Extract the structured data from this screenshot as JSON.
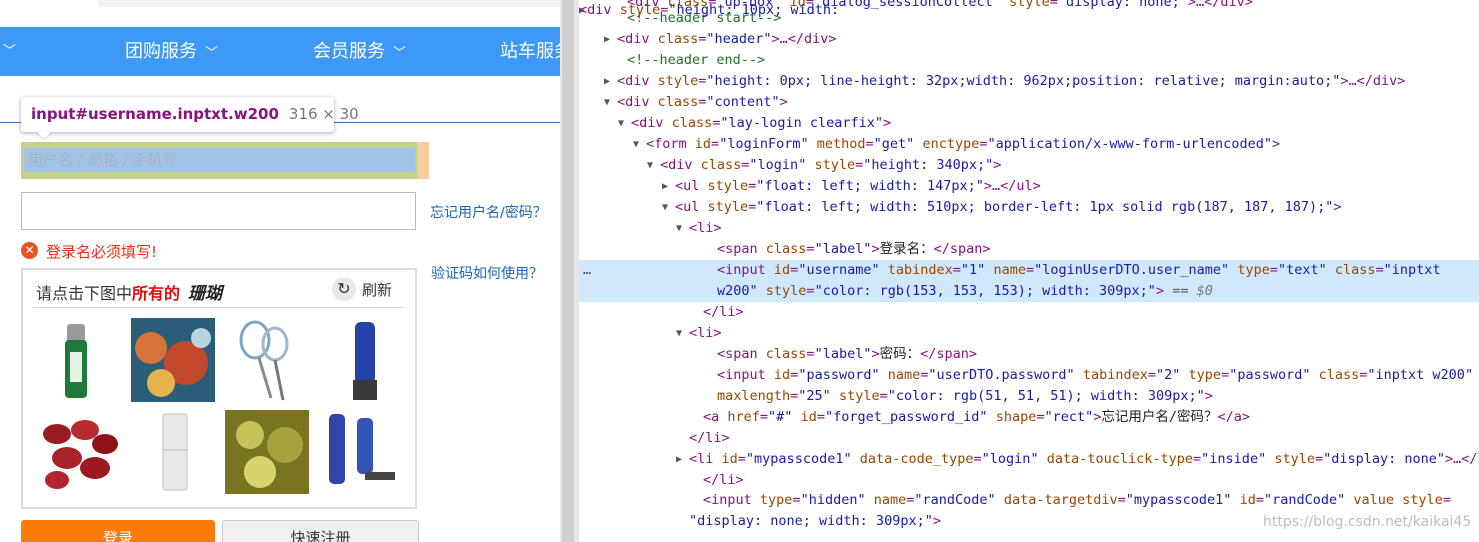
{
  "page": {
    "nav": [
      {
        "label": "团购服务"
      },
      {
        "label": "会员服务"
      },
      {
        "label": "站车服务"
      }
    ],
    "tooltip": {
      "selector": "input#username.inptxt.w200",
      "size": "316 × 30"
    },
    "username_placeholder": "用户名 / 邮箱 / 手机号",
    "forgot_link": "忘记用户名/密码？",
    "captcha_help_link": "验证码如何使用？",
    "error_text": "登录名必须填写!",
    "captcha": {
      "prompt_prefix": "请点击下图中",
      "prompt_highlight": "所有的",
      "prompt_target": "珊瑚",
      "refresh_label": "刷新"
    },
    "login_button": "登录",
    "register_button": "快速注册"
  },
  "colors": {
    "nav_bg": "#3d99f5",
    "login_btn": "#fb7b0a",
    "error": "#ef2f0f",
    "link": "#1a66b3",
    "selected_row": "#cfe8fc"
  },
  "devtools": {
    "lines": [
      {
        "pre": "",
        "tokens": [
          [
            "tn",
            "&lt;div "
          ],
          [
            "an",
            "class"
          ],
          [
            "tn",
            "="
          ],
          [
            "av",
            "\"up-box\""
          ],
          [
            "tn",
            " "
          ],
          [
            "an",
            "id"
          ],
          [
            "tn",
            "="
          ],
          [
            "av",
            "\"dialog_sessionCollect\""
          ],
          [
            "tn",
            " "
          ],
          [
            "an",
            "style"
          ],
          [
            "tn",
            "="
          ],
          [
            "av",
            "\"display: none;\""
          ],
          [
            "tn",
            "&gt;…&lt;/div&gt;"
          ]
        ]
      },
      {
        "pre": "",
        "tokens": [
          [
            "cm",
            "&lt;!--header start--&gt;"
          ]
        ]
      },
      {
        "pre": "▶",
        "tokens": [
          [
            "tn",
            "&lt;div "
          ],
          [
            "an",
            "class"
          ],
          [
            "tn",
            "="
          ],
          [
            "av",
            "\"header\""
          ],
          [
            "tn",
            "&gt;…&lt;/div&gt;"
          ]
        ]
      },
      {
        "pre": "",
        "tokens": [
          [
            "cm",
            "&lt;!--header end--&gt;"
          ]
        ]
      },
      {
        "pre": "▶",
        "tokens": [
          [
            "tn",
            "&lt;div "
          ],
          [
            "an",
            "style"
          ],
          [
            "tn",
            "="
          ],
          [
            "av",
            "\"height: 0px; line-height: 32px;width: 962px;position: relative; margin:auto;\""
          ],
          [
            "tn",
            "&gt;…&lt;/div&gt;"
          ]
        ]
      },
      {
        "pre": "▼",
        "tokens": [
          [
            "tn",
            "&lt;div "
          ],
          [
            "an",
            "class"
          ],
          [
            "tn",
            "="
          ],
          [
            "av",
            "\"content\""
          ],
          [
            "tn",
            "&gt;"
          ]
        ]
      },
      {
        "pre": "▼",
        "tokens": [
          [
            "tn",
            "&lt;div "
          ],
          [
            "an",
            "class"
          ],
          [
            "tn",
            "="
          ],
          [
            "av",
            "\"lay-login clearfix\""
          ],
          [
            "tn",
            "&gt;"
          ]
        ]
      },
      {
        "pre": "▼",
        "tokens": [
          [
            "tn",
            "&lt;form "
          ],
          [
            "an",
            "id"
          ],
          [
            "tn",
            "="
          ],
          [
            "av",
            "\"loginForm\""
          ],
          [
            "tn",
            " "
          ],
          [
            "an",
            "method"
          ],
          [
            "tn",
            "="
          ],
          [
            "av",
            "\"get\""
          ],
          [
            "tn",
            " "
          ],
          [
            "an",
            "enctype"
          ],
          [
            "tn",
            "="
          ],
          [
            "av",
            "\"application/x-www-form-urlencoded\""
          ],
          [
            "tn",
            "&gt;"
          ]
        ]
      },
      {
        "pre": "▼",
        "tokens": [
          [
            "tn",
            "&lt;div "
          ],
          [
            "an",
            "class"
          ],
          [
            "tn",
            "="
          ],
          [
            "av",
            "\"login\""
          ],
          [
            "tn",
            " "
          ],
          [
            "an",
            "style"
          ],
          [
            "tn",
            "="
          ],
          [
            "av",
            "\"height: 340px;\""
          ],
          [
            "tn",
            "&gt;"
          ]
        ]
      },
      {
        "pre": "▶",
        "tokens": [
          [
            "tn",
            "&lt;ul "
          ],
          [
            "an",
            "style"
          ],
          [
            "tn",
            "="
          ],
          [
            "av",
            "\"float: left; width: 147px;\""
          ],
          [
            "tn",
            "&gt;…&lt;/ul&gt;"
          ]
        ]
      },
      {
        "pre": "▼",
        "tokens": [
          [
            "tn",
            "&lt;ul "
          ],
          [
            "an",
            "style"
          ],
          [
            "tn",
            "="
          ],
          [
            "av",
            "\"float: left; width: 510px; border-left: 1px solid rgb(187, 187, 187);\""
          ],
          [
            "tn",
            "&gt;"
          ]
        ]
      },
      {
        "pre": "▼",
        "tokens": [
          [
            "tn",
            "&lt;li&gt;"
          ]
        ]
      },
      {
        "pre": "",
        "tokens": [
          [
            "tn",
            "&lt;span "
          ],
          [
            "an",
            "class"
          ],
          [
            "tn",
            "="
          ],
          [
            "av",
            "\"label\""
          ],
          [
            "tn",
            "&gt;"
          ],
          [
            "tx",
            "登录名："
          ],
          [
            "tn",
            "&lt;/span&gt;"
          ]
        ]
      },
      {
        "pre": "",
        "tokens": [
          [
            "tn",
            "&lt;input "
          ],
          [
            "an",
            "id"
          ],
          [
            "tn",
            "="
          ],
          [
            "av",
            "\"username\""
          ],
          [
            "tn",
            " "
          ],
          [
            "an",
            "tabindex"
          ],
          [
            "tn",
            "="
          ],
          [
            "av",
            "\"1\""
          ],
          [
            "tn",
            " "
          ],
          [
            "an",
            "name"
          ],
          [
            "tn",
            "="
          ],
          [
            "av",
            "\"loginUserDTO.user_name\""
          ],
          [
            "tn",
            " "
          ],
          [
            "an",
            "type"
          ],
          [
            "tn",
            "="
          ],
          [
            "av",
            "\"text\""
          ],
          [
            "tn",
            " "
          ],
          [
            "an",
            "class"
          ],
          [
            "tn",
            "="
          ],
          [
            "av",
            "\"inptxt"
          ]
        ]
      },
      {
        "pre": "",
        "tokens": [
          [
            "av",
            "w200\""
          ],
          [
            "tn",
            " "
          ],
          [
            "an",
            "style"
          ],
          [
            "tn",
            "="
          ],
          [
            "av",
            "\"color: rgb(153, 153, 153); width: 309px;\""
          ],
          [
            "tn",
            "&gt;"
          ],
          [
            "eq",
            " == "
          ],
          [
            "dollar",
            "$0"
          ]
        ]
      },
      {
        "pre": "",
        "tokens": [
          [
            "tn",
            "&lt;/li&gt;"
          ]
        ]
      },
      {
        "pre": "▼",
        "tokens": [
          [
            "tn",
            "&lt;li&gt;"
          ]
        ]
      },
      {
        "pre": "",
        "tokens": [
          [
            "tn",
            "&lt;span "
          ],
          [
            "an",
            "class"
          ],
          [
            "tn",
            "="
          ],
          [
            "av",
            "\"label\""
          ],
          [
            "tn",
            "&gt;"
          ],
          [
            "tx",
            "密码："
          ],
          [
            "tn",
            "&lt;/span&gt;"
          ]
        ]
      },
      {
        "pre": "",
        "tokens": [
          [
            "tn",
            "&lt;input "
          ],
          [
            "an",
            "id"
          ],
          [
            "tn",
            "="
          ],
          [
            "av",
            "\"password\""
          ],
          [
            "tn",
            " "
          ],
          [
            "an",
            "name"
          ],
          [
            "tn",
            "="
          ],
          [
            "av",
            "\"userDTO.password\""
          ],
          [
            "tn",
            " "
          ],
          [
            "an",
            "tabindex"
          ],
          [
            "tn",
            "="
          ],
          [
            "av",
            "\"2\""
          ],
          [
            "tn",
            " "
          ],
          [
            "an",
            "type"
          ],
          [
            "tn",
            "="
          ],
          [
            "av",
            "\"password\""
          ],
          [
            "tn",
            " "
          ],
          [
            "an",
            "class"
          ],
          [
            "tn",
            "="
          ],
          [
            "av",
            "\"inptxt w200\""
          ]
        ]
      },
      {
        "pre": "",
        "tokens": [
          [
            "an",
            "maxlength"
          ],
          [
            "tn",
            "="
          ],
          [
            "av",
            "\"25\""
          ],
          [
            "tn",
            " "
          ],
          [
            "an",
            "style"
          ],
          [
            "tn",
            "="
          ],
          [
            "av",
            "\"color: rgb(51, 51, 51); width: 309px;\""
          ],
          [
            "tn",
            "&gt;"
          ]
        ]
      },
      {
        "pre": "",
        "tokens": [
          [
            "tn",
            "&lt;a "
          ],
          [
            "an",
            "href"
          ],
          [
            "tn",
            "="
          ],
          [
            "av",
            "\"#\""
          ],
          [
            "tn",
            " "
          ],
          [
            "an",
            "id"
          ],
          [
            "tn",
            "="
          ],
          [
            "av",
            "\"forget_password_id\""
          ],
          [
            "tn",
            " "
          ],
          [
            "an",
            "shape"
          ],
          [
            "tn",
            "="
          ],
          [
            "av",
            "\"rect\""
          ],
          [
            "tn",
            "&gt;"
          ],
          [
            "tx",
            "忘记用户名/密码？"
          ],
          [
            "tn",
            "&lt;/a&gt;"
          ]
        ]
      },
      {
        "pre": "",
        "tokens": [
          [
            "tn",
            "&lt;/li&gt;"
          ]
        ]
      },
      {
        "pre": "▶",
        "tokens": [
          [
            "tn",
            "&lt;li "
          ],
          [
            "an",
            "id"
          ],
          [
            "tn",
            "="
          ],
          [
            "av",
            "\"mypasscode1\""
          ],
          [
            "tn",
            " "
          ],
          [
            "an",
            "data-code_type"
          ],
          [
            "tn",
            "="
          ],
          [
            "av",
            "\"login\""
          ],
          [
            "tn",
            " "
          ],
          [
            "an",
            "data-touclick-type"
          ],
          [
            "tn",
            "="
          ],
          [
            "av",
            "\"inside\""
          ],
          [
            "tn",
            " "
          ],
          [
            "an",
            "style"
          ],
          [
            "tn",
            "="
          ],
          [
            "av",
            "\"display: none\""
          ],
          [
            "tn",
            "&gt;…&lt;/li&gt;"
          ]
        ]
      },
      {
        "pre": "",
        "tokens": [
          [
            "tn",
            "&lt;/li&gt;"
          ]
        ]
      },
      {
        "pre": "",
        "tokens": [
          [
            "tn",
            "&lt;input "
          ],
          [
            "an",
            "type"
          ],
          [
            "tn",
            "="
          ],
          [
            "av",
            "\"hidden\""
          ],
          [
            "tn",
            " "
          ],
          [
            "an",
            "name"
          ],
          [
            "tn",
            "="
          ],
          [
            "av",
            "\"randCode\""
          ],
          [
            "tn",
            " "
          ],
          [
            "an",
            "data-targetdiv"
          ],
          [
            "tn",
            "="
          ],
          [
            "av",
            "\"mypasscode1\""
          ],
          [
            "tn",
            " "
          ],
          [
            "an",
            "id"
          ],
          [
            "tn",
            "="
          ],
          [
            "av",
            "\"randCode\""
          ],
          [
            "tn",
            " "
          ],
          [
            "an",
            "value"
          ],
          [
            "tn",
            " "
          ],
          [
            "an",
            "style"
          ],
          [
            "tn",
            "="
          ]
        ]
      },
      {
        "pre": "",
        "tokens": [
          [
            "av",
            "\"display: none; width: 309px;\""
          ],
          [
            "tn",
            "&gt;"
          ]
        ]
      },
      {
        "pre": "▶",
        "tokens": [
          [
            "tn",
            "&lt;div "
          ],
          [
            "an",
            "style"
          ],
          [
            "tn",
            "="
          ],
          [
            "av",
            "\"height: 10px; width:"
          ]
        ]
      }
    ],
    "watermark": "https://blog.csdn.net/kaikai45"
  }
}
